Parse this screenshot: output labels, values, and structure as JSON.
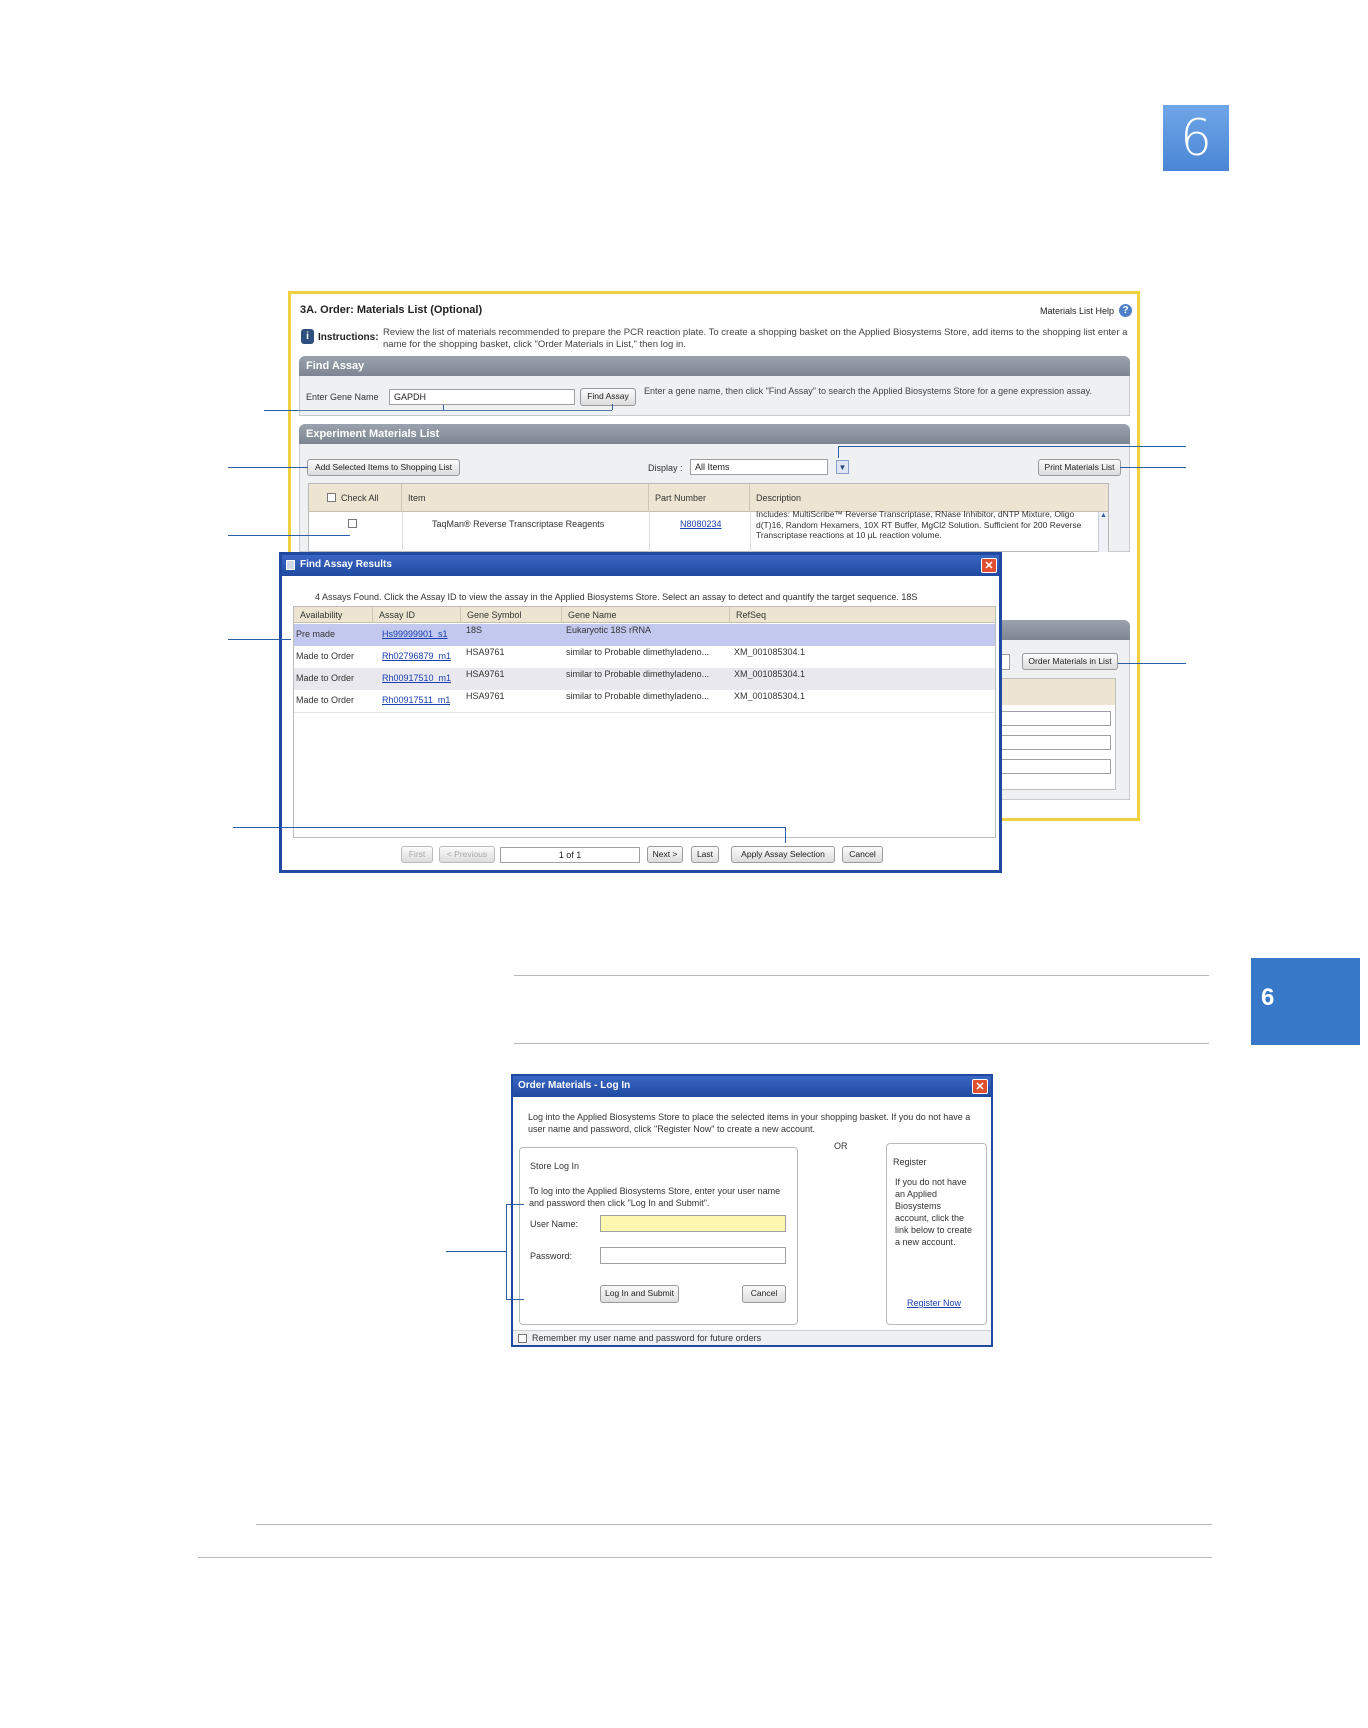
{
  "chapter": {
    "number": "6"
  },
  "main_window": {
    "title": "3A. Order: Materials List (Optional)",
    "help_link": "Materials List Help",
    "instructions_label": "Instructions:",
    "instructions_text": "Review the list of materials recommended to prepare the PCR reaction plate. To create a shopping basket on the Applied Biosystems Store, add items to the shopping list enter a name for the shopping basket, click \"Order Materials in List,\" then log in.",
    "find_assay": {
      "header": "Find Assay",
      "gene_label": "Enter Gene Name",
      "gene_value": "GAPDH",
      "button": "Find Assay",
      "hint": "Enter a gene name, then click \"Find Assay\" to search the Applied Biosystems Store for a gene expression assay."
    },
    "materials": {
      "header": "Experiment Materials List",
      "add_button": "Add Selected Items to Shopping List",
      "display_label": "Display :",
      "display_value": "All Items",
      "print_button": "Print Materials List",
      "columns": {
        "check_all": "Check All",
        "item": "Item",
        "part_number": "Part Number",
        "description": "Description"
      },
      "rows": [
        {
          "item": "TaqMan® Reverse Transcriptase Reagents",
          "part_number": "N8080234",
          "description": "Includes: MultiScribe™ Reverse Transcriptase, RNase Inhibitor, dNTP Mixture, Oligo d(T)16, Random Hexamers, 10X RT Buffer, MgCl2 Solution. Sufficient for 200 Reverse Transcriptase reactions at 10 µL reaction volume."
        }
      ],
      "order_button": "Order Materials in List"
    }
  },
  "find_assay_results": {
    "title": "Find Assay Results",
    "summary": "4 Assays Found. Click the Assay ID to view the assay in the Applied Biosystems Store. Select an assay to detect and quantify the target sequence. 18S",
    "columns": [
      "Availability",
      "Assay ID",
      "Gene Symbol",
      "Gene Name",
      "RefSeq"
    ],
    "rows": [
      {
        "availability": "Pre made",
        "assay_id": "Hs99999901_s1",
        "gene_symbol": "18S",
        "gene_name": "Eukaryotic 18S rRNA",
        "refseq": "",
        "selected": true
      },
      {
        "availability": "Made to Order",
        "assay_id": "Rh02796879_m1",
        "gene_symbol": "HSA9761",
        "gene_name": "similar to Probable dimethyladeno...",
        "refseq": "XM_001085304.1",
        "selected": false
      },
      {
        "availability": "Made to Order",
        "assay_id": "Rh00917510_m1",
        "gene_symbol": "HSA9761",
        "gene_name": "similar to Probable dimethyladeno...",
        "refseq": "XM_001085304.1",
        "selected": false
      },
      {
        "availability": "Made to Order",
        "assay_id": "Rh00917511_m1",
        "gene_symbol": "HSA9761",
        "gene_name": "similar to Probable dimethyladeno...",
        "refseq": "XM_001085304.1",
        "selected": false
      }
    ],
    "pagination": {
      "first": "First",
      "previous": "< Previous",
      "page": "1 of 1",
      "next": "Next >",
      "last": "Last"
    },
    "apply_button": "Apply Assay Selection",
    "cancel_button": "Cancel"
  },
  "login_dialog": {
    "title": "Order Materials - Log In",
    "intro": "Log into the Applied Biosystems Store to place the selected items in your shopping basket. If you do not have a user name and password, click \"Register Now\" to create a new account.",
    "store_login": {
      "heading": "Store Log In",
      "text": "To log into the Applied Biosystems Store, enter your user name and password then click \"Log In and Submit\".",
      "username_label": "User Name:",
      "username_value": "",
      "password_label": "Password:",
      "password_value": "",
      "submit_button": "Log In and Submit",
      "cancel_button": "Cancel"
    },
    "or_label": "OR",
    "register": {
      "heading": "Register",
      "text": "If you do not have an Applied Biosystems account, click the link below to create a new account.",
      "link": "Register Now"
    },
    "remember_label": "Remember my user name and password for future orders"
  },
  "colors": {
    "accent": "#3878c8",
    "dialog_title": "#1f4aa0",
    "highlight_frame": "#f0d040",
    "selected_row": "#c3c9ee"
  }
}
